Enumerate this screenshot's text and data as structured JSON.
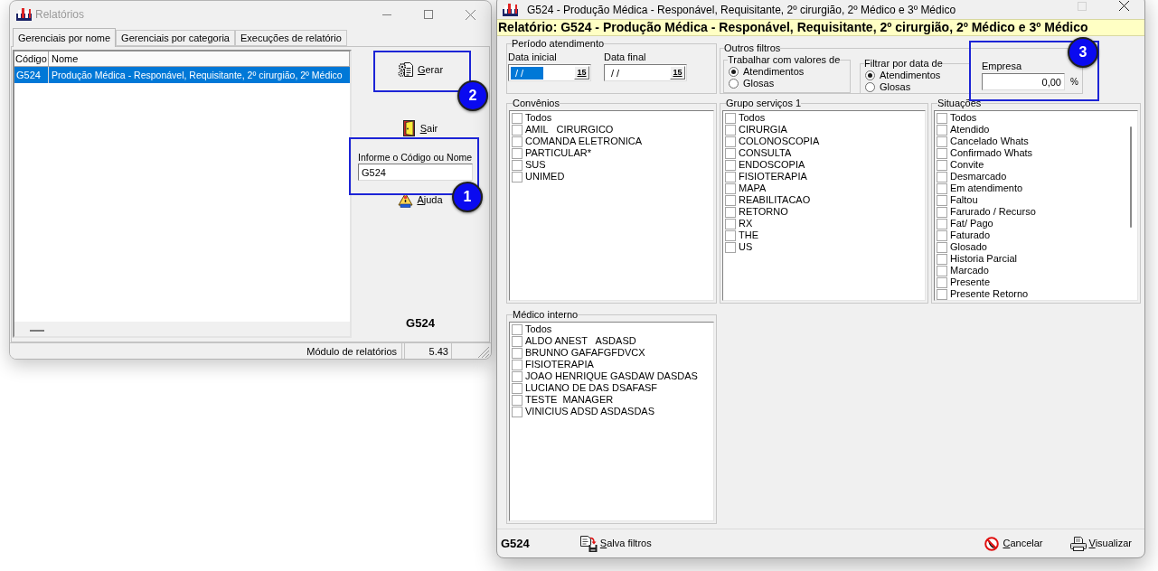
{
  "report_window": {
    "title": "Relatórios",
    "active": false,
    "controls": [
      {
        "kind": "minimize",
        "disabled": false
      },
      {
        "kind": "maximize",
        "disabled": false
      },
      {
        "kind": "close",
        "disabled": false
      }
    ],
    "tabs": [
      {
        "label": "Gerenciais por nome",
        "selected": true
      },
      {
        "label": "Gerenciais por categoria",
        "selected": false
      },
      {
        "label": "Execuções de relatório",
        "selected": false
      }
    ],
    "table": {
      "columns": [
        "Código",
        "Nome"
      ],
      "rows": [
        {
          "cells": [
            "G524",
            "Produção Médica - Responável, Requisitante, 2º cirurgião, 2º Médico"
          ],
          "selected": true
        }
      ]
    },
    "actions": [
      {
        "kind": "generate",
        "label": "Gerar"
      },
      {
        "kind": "exit",
        "label": "Sair"
      }
    ],
    "search": {
      "label": "Informe o Código ou Nome",
      "value": "G524"
    },
    "help": {
      "label": "Ajuda"
    },
    "code": "G524",
    "status_bar": [
      "Módulo de relatórios",
      "5.43"
    ]
  },
  "filter_window": {
    "title": "G524 - Produção Médica - Responável, Requisitante, 2º cirurgião, 2º Médico e 3º Médico",
    "active": true,
    "controls": [
      {
        "kind": "maximize",
        "disabled": true
      },
      {
        "kind": "close",
        "disabled": false
      }
    ],
    "banner": "Relatório: G524 - Produção Médica - Responável, Requisitante, 2º cirurgião, 2º Médico e 3º Médico",
    "period": {
      "label": "Período atendimento",
      "fields": [
        {
          "label": "Data inicial",
          "value": "/ /",
          "focused": true,
          "button": "15"
        },
        {
          "label": "Data final",
          "value": "/ /",
          "focused": false,
          "button": "15"
        }
      ]
    },
    "other_filters": {
      "label": "Outros filtros",
      "groups": [
        {
          "label": "Trabalhar com valores de",
          "options": [
            {
              "label": "Atendimentos",
              "selected": true
            },
            {
              "label": "Glosas",
              "selected": false
            }
          ]
        },
        {
          "label": "Filtrar por data de",
          "options": [
            {
              "label": "Atendimentos",
              "selected": true
            },
            {
              "label": "Glosas",
              "selected": false
            }
          ]
        }
      ],
      "company": {
        "label": "Empresa",
        "value": "0,00",
        "unit": "%"
      }
    },
    "lists": [
      {
        "label": "Convênios",
        "scrollbar": false,
        "items": [
          {
            "label": "Todos",
            "checked": false
          },
          {
            "label": "AMIL   CIRURGICO",
            "checked": false
          },
          {
            "label": "COMANDA ELETRONICA",
            "checked": false
          },
          {
            "label": "PARTICULAR*",
            "checked": false
          },
          {
            "label": "SUS",
            "checked": false
          },
          {
            "label": "UNIMED",
            "checked": false
          }
        ]
      },
      {
        "label": "Grupo serviços 1",
        "scrollbar": false,
        "items": [
          {
            "label": "Todos",
            "checked": false
          },
          {
            "label": "CIRURGIA",
            "checked": false
          },
          {
            "label": "COLONOSCOPIA",
            "checked": false
          },
          {
            "label": "CONSULTA",
            "checked": false
          },
          {
            "label": "ENDOSCOPIA",
            "checked": false
          },
          {
            "label": "FISIOTERAPIA",
            "checked": false
          },
          {
            "label": "MAPA",
            "checked": false
          },
          {
            "label": "REABILITACAO",
            "checked": false
          },
          {
            "label": "RETORNO",
            "checked": false
          },
          {
            "label": "RX",
            "checked": false
          },
          {
            "label": "THE",
            "checked": false
          },
          {
            "label": "US",
            "checked": false
          }
        ]
      },
      {
        "label": "Situações",
        "scrollbar": true,
        "items": [
          {
            "label": "Todos",
            "checked": false
          },
          {
            "label": "Atendido",
            "checked": false
          },
          {
            "label": "Cancelado Whats",
            "checked": false
          },
          {
            "label": "Confirmado Whats",
            "checked": false
          },
          {
            "label": "Convite",
            "checked": false
          },
          {
            "label": "Desmarcado",
            "checked": false
          },
          {
            "label": "Em atendimento",
            "checked": false
          },
          {
            "label": "Faltou",
            "checked": false
          },
          {
            "label": "Farurado / Recurso",
            "checked": false
          },
          {
            "label": "Fat/ Pago",
            "checked": false
          },
          {
            "label": "Faturado",
            "checked": false
          },
          {
            "label": "Glosado",
            "checked": false
          },
          {
            "label": "Historia Parcial",
            "checked": false
          },
          {
            "label": "Marcado",
            "checked": false
          },
          {
            "label": "Presente",
            "checked": false
          },
          {
            "label": "Presente Retorno",
            "checked": false
          }
        ]
      }
    ],
    "doctors": {
      "label": "Médico interno",
      "scrollbar": false,
      "items": [
        {
          "label": "Todos",
          "checked": false
        },
        {
          "label": "ALDO ANEST   ASDASD",
          "checked": false
        },
        {
          "label": "BRUNNO GAFAFGFDVCX",
          "checked": false
        },
        {
          "label": "FISIOTERAPIA",
          "checked": false
        },
        {
          "label": "JOAO HENRIQUE GASDAW DASDAS",
          "checked": false
        },
        {
          "label": "LUCIANO DE DAS DSAFASF",
          "checked": false
        },
        {
          "label": "TESTE  MANAGER",
          "checked": false
        },
        {
          "label": "VINICIUS ADSD ASDASDAS",
          "checked": false
        }
      ]
    },
    "code": "G524",
    "buttons": [
      {
        "kind": "save",
        "label": "Salva filtros"
      },
      {
        "kind": "cancel",
        "label": "Cancelar"
      },
      {
        "kind": "preview",
        "label": "Visualizar"
      }
    ]
  },
  "annotations": [
    {
      "number": "1"
    },
    {
      "number": "2"
    },
    {
      "number": "3"
    }
  ]
}
